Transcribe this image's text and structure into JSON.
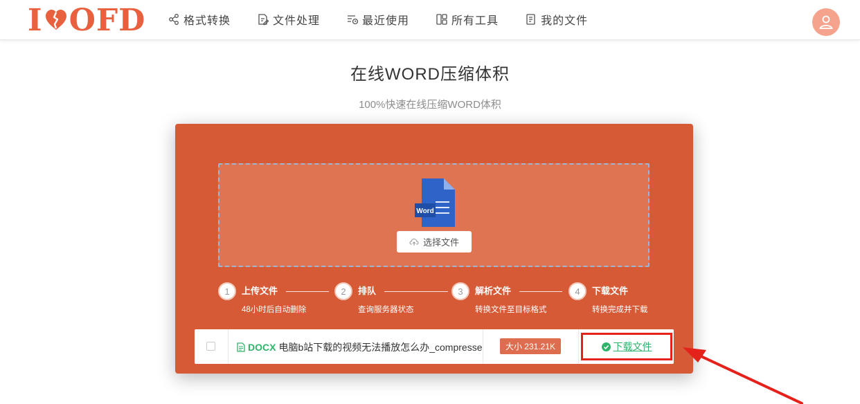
{
  "header": {
    "logo_left": "I",
    "logo_right": "OFD",
    "nav": [
      {
        "label": "格式转换",
        "icon": "share-nodes-icon"
      },
      {
        "label": "文件处理",
        "icon": "file-edit-icon"
      },
      {
        "label": "最近使用",
        "icon": "recent-list-icon"
      },
      {
        "label": "所有工具",
        "icon": "tools-grid-icon"
      },
      {
        "label": "我的文件",
        "icon": "document-list-icon"
      }
    ],
    "avatar_icon": "user-icon"
  },
  "main": {
    "title": "在线WORD压缩体积",
    "subtitle": "100%快速在线压缩WORD体积"
  },
  "upload": {
    "word_icon_label": "Word",
    "choose_button": "选择文件"
  },
  "steps": [
    {
      "num": "1",
      "title": "上传文件",
      "desc": "48小时后自动删除"
    },
    {
      "num": "2",
      "title": "排队",
      "desc": "查询服务器状态"
    },
    {
      "num": "3",
      "title": "解析文件",
      "desc": "转换文件至目标格式"
    },
    {
      "num": "4",
      "title": "下载文件",
      "desc": "转换完成并下载"
    }
  ],
  "file": {
    "ext": "DOCX",
    "name": "电脑b站下载的视频无法播放怎么办_compresse",
    "size": "大小 231.21K",
    "download": "下载文件"
  },
  "colors": {
    "brand": "#e8603e",
    "panel": "#d75a36",
    "dropzone": "#df7453",
    "success": "#2fb36b",
    "highlight": "#e5211b"
  }
}
